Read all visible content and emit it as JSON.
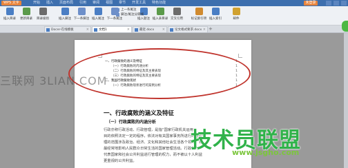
{
  "titlebar": {
    "app_name": "WPS 文字",
    "menu": [
      "开始",
      "插入",
      "页面布局",
      "引用",
      "审阅",
      "视图",
      "章节",
      "开发工具",
      "特色功能"
    ],
    "login_label": "未登录"
  },
  "ribbon": {
    "buttons": [
      {
        "label": "插入目录",
        "color": "#4a7ec4"
      },
      {
        "label": "更新目录",
        "color": "#5a9a4a"
      },
      {
        "label": "目录级别",
        "color": "#6b6b6b"
      },
      {
        "label": "插入脚注",
        "color": "#4a7ec4"
      },
      {
        "label": "下一条脚注",
        "color": "#6d8fc9"
      },
      {
        "label": "插入尾注",
        "color": "#4a7ec4"
      },
      {
        "label": "下一条尾注",
        "color": "#6d8fc9"
      },
      {
        "label": "插入题注",
        "color": "#4a7ec4"
      },
      {
        "label": "插入表目录",
        "color": "#5a9a4a"
      },
      {
        "label": "交叉引用",
        "color": "#6b6b6b"
      },
      {
        "label": "标记索引项",
        "color": "#d08a2f"
      },
      {
        "label": "插入索引",
        "color": "#4a7ec4"
      },
      {
        "label": "邮件",
        "color": "#d0a12f"
      }
    ],
    "small": [
      "上一条尾注",
      "脚注/尾注分隔线"
    ]
  },
  "tabs": [
    {
      "label": "Docer-在线模板"
    },
    {
      "label": "文档1",
      "active": true
    },
    {
      "label": "最近.docx"
    },
    {
      "label": "论文格式要求.docx"
    }
  ],
  "toc": {
    "lines": [
      {
        "text": "一、行政腐败的涵义及特征",
        "dots": "1",
        "kind": "head"
      },
      {
        "text": "（一）行政腐败的内涵分析",
        "dots": "1",
        "kind": "sub"
      },
      {
        "text": "（二）行政腐败的特征及其主要表现",
        "dots": "1",
        "kind": "sub"
      },
      {
        "text": "（三）行政腐败的特征及其主要表现",
        "dots": "1",
        "kind": "sub"
      },
      {
        "text": "二、我国行政腐败现状",
        "dots": "1",
        "kind": "head"
      },
      {
        "text": "（一）行政腐败现状进行的案例分析",
        "dots": "1",
        "kind": "sub"
      }
    ]
  },
  "body": {
    "heading": "一、行政腐败的涵义及特征",
    "subheading": "（一）行政腐败的内涵分析",
    "paragraph": [
      "行政亦称行政活动、行政管理，是指“国家行政机关运用",
      "目的依照法定一定的程序，依法对有关国家事务所进行的组织管",
      "理的范围涉及政治、经济、文化和其他社会生活各个领域，有",
      "最经常地影响人民群众日常生活的国家管理活动。行政权力",
      "代表国家和社会公共利益进行管理的权力，而不被以十人利益",
      "更重视的公共利益。"
    ]
  },
  "watermarks": {
    "left": "三联网 3LIAN.COM",
    "brand": "技术员联盟",
    "url": "www.jsgho.com"
  }
}
